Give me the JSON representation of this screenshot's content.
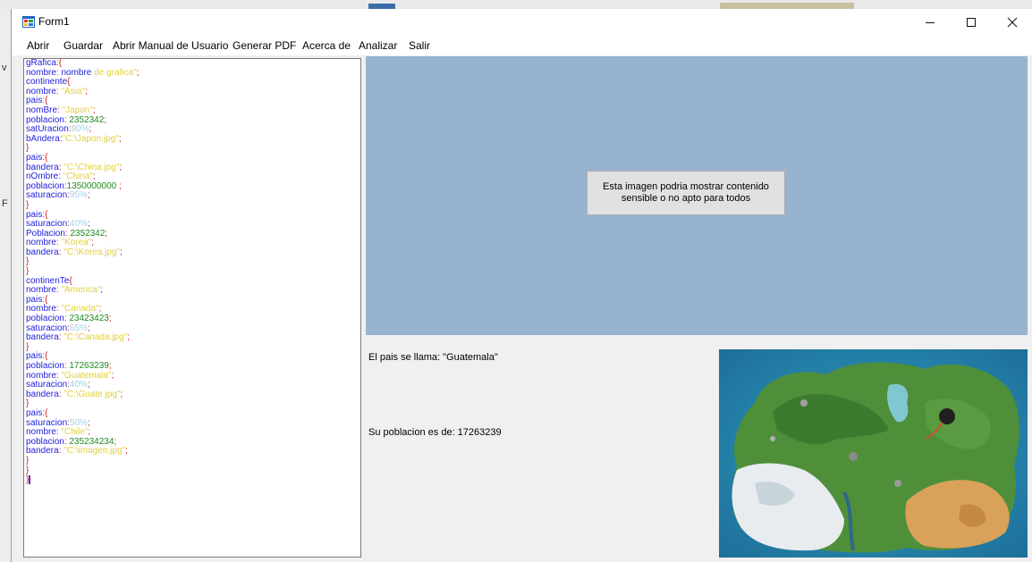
{
  "window": {
    "title": "Form1"
  },
  "menu": {
    "items": [
      {
        "id": "abrir",
        "label": "Abrir"
      },
      {
        "id": "guardar",
        "label": "Guardar"
      },
      {
        "id": "manual",
        "label": "Abrir Manual de Usuario"
      },
      {
        "id": "pdf",
        "label": "Generar PDF"
      },
      {
        "id": "acerca",
        "label": "Acerca de"
      },
      {
        "id": "analizar",
        "label": "Analizar"
      },
      {
        "id": "salir",
        "label": "Salir"
      }
    ]
  },
  "editor": {
    "lines": [
      [
        [
          "kw",
          "gRafica"
        ],
        [
          "pun",
          ":{"
        ]
      ],
      [
        [
          "kw",
          "nombre"
        ],
        [
          "pun",
          ":"
        ],
        [
          "kw",
          " nombre "
        ],
        [
          "str",
          "de grafica\""
        ],
        [
          "pun",
          ";"
        ]
      ],
      [
        [
          "kw",
          "continente"
        ],
        [
          "pun",
          "{"
        ]
      ],
      [
        [
          "kw",
          "nombre"
        ],
        [
          "pun",
          ":"
        ],
        [
          "str",
          " \"Asia\""
        ],
        [
          "pun",
          ";"
        ]
      ],
      [
        [
          "kw",
          "pais"
        ],
        [
          "pun",
          ":{"
        ]
      ],
      [
        [
          "kw",
          "nomBre"
        ],
        [
          "pun",
          ":"
        ],
        [
          "str",
          " \"Japon\""
        ],
        [
          "pun",
          ";"
        ]
      ],
      [
        [
          "kw",
          "poblacion"
        ],
        [
          "pun",
          ":"
        ],
        [
          "num",
          " 2352342"
        ],
        [
          "pun",
          ";"
        ]
      ],
      [
        [
          "kw",
          "satUracion"
        ],
        [
          "pun",
          ":"
        ],
        [
          "pct",
          "80%"
        ],
        [
          "pun",
          ";"
        ]
      ],
      [
        [
          "kw",
          "bAndera"
        ],
        [
          "pun",
          ":"
        ],
        [
          "str",
          "\"C:\\Japon.jpg\""
        ],
        [
          "pun",
          ";"
        ]
      ],
      [
        [
          "pun",
          "}"
        ]
      ],
      [
        [
          "kw",
          "pais"
        ],
        [
          "pun",
          ":{"
        ]
      ],
      [
        [
          "kw",
          "bandera"
        ],
        [
          "pun",
          ":"
        ],
        [
          "str",
          " \"C:\\China.jpg\""
        ],
        [
          "pun",
          ";"
        ]
      ],
      [
        [
          "kw",
          "nOmbre"
        ],
        [
          "pun",
          ":"
        ],
        [
          "str",
          " \"China\""
        ],
        [
          "pun",
          ";"
        ]
      ],
      [
        [
          "kw",
          "poblacion"
        ],
        [
          "pun",
          ":"
        ],
        [
          "num",
          "1350000000"
        ],
        [
          "pun",
          " ;"
        ]
      ],
      [
        [
          "kw",
          "saturacion"
        ],
        [
          "pun",
          ":"
        ],
        [
          "pct",
          "95%"
        ],
        [
          "pun",
          ";"
        ]
      ],
      [
        [
          "pun",
          "}"
        ]
      ],
      [
        [
          "kw",
          "pais"
        ],
        [
          "pun",
          ":{"
        ]
      ],
      [
        [
          "kw",
          "saturacion"
        ],
        [
          "pun",
          ":"
        ],
        [
          "pct",
          "40%"
        ],
        [
          "pun",
          ";"
        ]
      ],
      [
        [
          "kw",
          "Poblacion"
        ],
        [
          "pun",
          ":"
        ],
        [
          "num",
          " 2352342"
        ],
        [
          "pun",
          ";"
        ]
      ],
      [
        [
          "kw",
          "nombre"
        ],
        [
          "pun",
          ":"
        ],
        [
          "str",
          " \"Korea\""
        ],
        [
          "pun",
          ";"
        ]
      ],
      [
        [
          "kw",
          "bandera"
        ],
        [
          "pun",
          ":"
        ],
        [
          "str",
          " \"C:\\Korea.jpg\""
        ],
        [
          "pun",
          ";"
        ]
      ],
      [
        [
          "pun",
          "}"
        ]
      ],
      [
        [
          "pun",
          "}"
        ]
      ],
      [
        [
          "kw",
          "continenTe"
        ],
        [
          "pun",
          "{"
        ]
      ],
      [
        [
          "kw",
          "nombre"
        ],
        [
          "pun",
          ":"
        ],
        [
          "str",
          " \"America\""
        ],
        [
          "pun",
          ";"
        ]
      ],
      [
        [
          "kw",
          "pais"
        ],
        [
          "pun",
          ":{"
        ]
      ],
      [
        [
          "kw",
          "nombre"
        ],
        [
          "pun",
          ":"
        ],
        [
          "str",
          " \"Canada\""
        ],
        [
          "pun",
          ";"
        ]
      ],
      [
        [
          "kw",
          "poblacion"
        ],
        [
          "pun",
          ":"
        ],
        [
          "num",
          " 23423423"
        ],
        [
          "pun",
          ";"
        ]
      ],
      [
        [
          "kw",
          "saturacion"
        ],
        [
          "pun",
          ":"
        ],
        [
          "pct",
          "65%"
        ],
        [
          "pun",
          ";"
        ]
      ],
      [
        [
          "kw",
          "bandera"
        ],
        [
          "pun",
          ":"
        ],
        [
          "str",
          " \"C:\\Canada.jpg\""
        ],
        [
          "pun",
          ";"
        ]
      ],
      [
        [
          "pun",
          "}"
        ]
      ],
      [
        [
          "kw",
          "pais"
        ],
        [
          "pun",
          ":{"
        ]
      ],
      [
        [
          "kw",
          "poblacion"
        ],
        [
          "pun",
          ":"
        ],
        [
          "num",
          " 17263239"
        ],
        [
          "pun",
          ";"
        ]
      ],
      [
        [
          "kw",
          "nombre"
        ],
        [
          "pun",
          ":"
        ],
        [
          "str",
          " \"Guatemala\""
        ],
        [
          "pun",
          ";"
        ]
      ],
      [
        [
          "kw",
          "saturacion"
        ],
        [
          "pun",
          ":"
        ],
        [
          "pct",
          "40%"
        ],
        [
          "pun",
          ";"
        ]
      ],
      [
        [
          "kw",
          "bandera"
        ],
        [
          "pun",
          ":"
        ],
        [
          "str",
          " \"C:\\Guate.jpg\""
        ],
        [
          "pun",
          ";"
        ]
      ],
      [
        [
          "pun",
          "}"
        ]
      ],
      [
        [
          "kw",
          "pais"
        ],
        [
          "pun",
          ":{"
        ]
      ],
      [
        [
          "kw",
          "saturacion"
        ],
        [
          "pun",
          ":"
        ],
        [
          "pct",
          "50%"
        ],
        [
          "pun",
          ";"
        ]
      ],
      [
        [
          "kw",
          "nombre"
        ],
        [
          "pun",
          ":"
        ],
        [
          "str",
          " \"Chile\""
        ],
        [
          "pun",
          ";"
        ]
      ],
      [
        [
          "kw",
          "poblacion"
        ],
        [
          "pun",
          ":"
        ],
        [
          "num",
          " 235234234"
        ],
        [
          "pun",
          ";"
        ]
      ],
      [
        [
          "kw",
          "bandera"
        ],
        [
          "pun",
          ":"
        ],
        [
          "str",
          " \"C:\\imagen.jpg\""
        ],
        [
          "pun",
          ";"
        ]
      ],
      [
        [
          "pun",
          "}"
        ]
      ],
      [
        [
          "pun",
          "}"
        ]
      ],
      [
        [
          "pun",
          "}"
        ]
      ]
    ]
  },
  "preview": {
    "warning": "Esta imagen podria mostrar contenido sensible o no apto para todos"
  },
  "info": {
    "pais_label": "El pais se llama: \"Guatemala\"",
    "poblacion_label": "Su poblacion es de: 17263239"
  },
  "colors": {
    "preview_bg": "#98b3cf",
    "keyword": "#1e1edc",
    "punctuation": "#d02020",
    "number": "#1f8a1f",
    "string": "#e0d040",
    "percent": "#9fd2e4"
  }
}
